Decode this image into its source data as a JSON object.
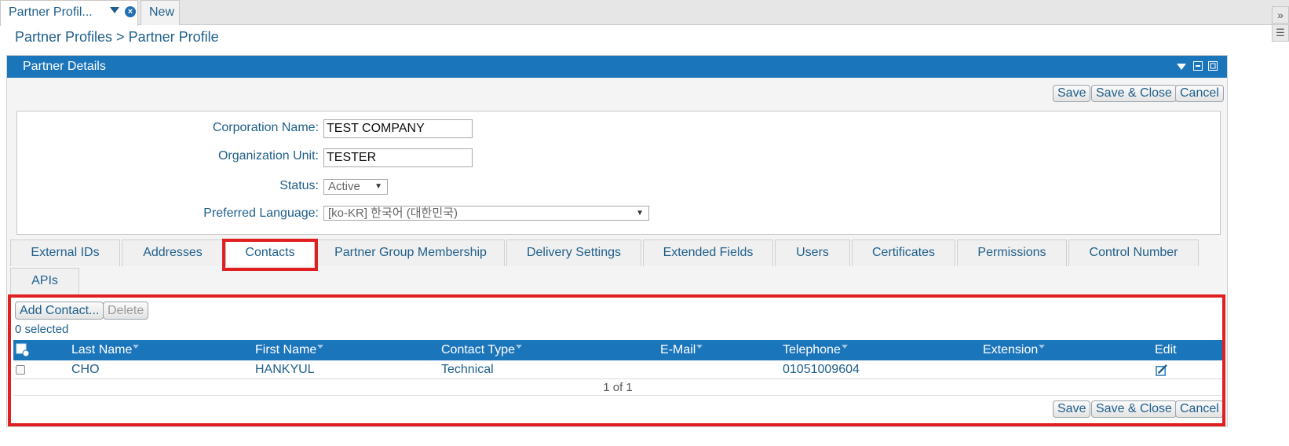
{
  "doc_tabs": [
    {
      "label": "Partner Profil..."
    },
    {
      "label": "New"
    }
  ],
  "breadcrumb": "Partner Profiles > Partner Profile",
  "panel": {
    "title": "Partner Details",
    "buttons": {
      "save": "Save",
      "save_close": "Save & Close",
      "cancel": "Cancel"
    }
  },
  "form": {
    "corporation_name": {
      "label": "Corporation Name:",
      "value": "TEST COMPANY"
    },
    "organization_unit": {
      "label": "Organization Unit:",
      "value": "TESTER"
    },
    "status": {
      "label": "Status:",
      "value": "Active"
    },
    "preferred_language": {
      "label": "Preferred Language:",
      "value": "[ko-KR] 한국어 (대한민국)"
    }
  },
  "subtabs": [
    {
      "label": "External IDs"
    },
    {
      "label": "Addresses"
    },
    {
      "label": "Contacts"
    },
    {
      "label": "Partner Group Membership"
    },
    {
      "label": "Delivery Settings"
    },
    {
      "label": "Extended Fields"
    },
    {
      "label": "Users"
    },
    {
      "label": "Certificates"
    },
    {
      "label": "Permissions"
    },
    {
      "label": "Control Number"
    },
    {
      "label": "APIs"
    }
  ],
  "active_subtab": "Contacts",
  "contacts": {
    "add_button": "Add Contact...",
    "delete_button": "Delete",
    "selected_text": "0 selected",
    "columns": [
      "Last Name",
      "First Name",
      "Contact Type",
      "E-Mail",
      "Telephone",
      "Extension",
      "Edit"
    ],
    "rows": [
      {
        "last_name": "CHO",
        "first_name": "HANKYUL",
        "contact_type": "Technical",
        "email": "",
        "telephone": "01051009604",
        "extension": ""
      }
    ],
    "pager": "1 of 1"
  },
  "colors": {
    "accent": "#1b75bb",
    "link": "#1f5f8b",
    "highlight": "#e02020"
  },
  "icons": [
    "dropdown-arrow-icon",
    "close-tab-icon",
    "expand-panels-icon",
    "panel-menu-icon",
    "minimize-icon",
    "maximize-icon",
    "select-all-icon",
    "edit-icon"
  ]
}
